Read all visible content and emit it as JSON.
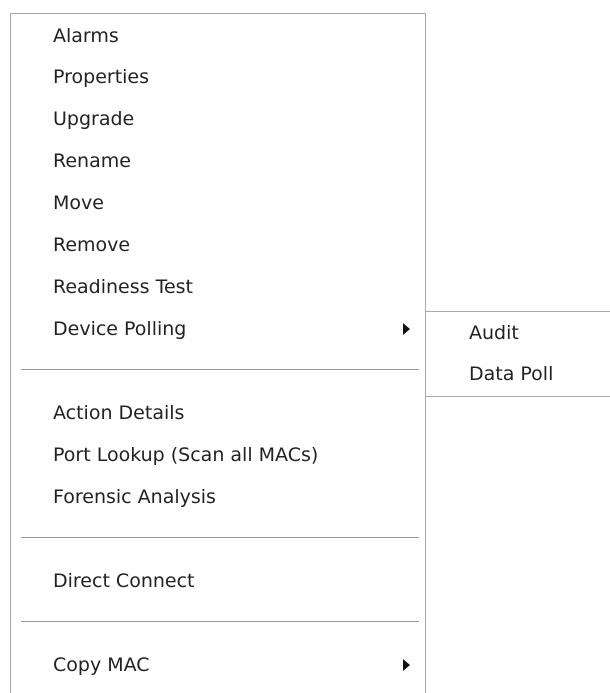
{
  "context_menu": {
    "items": [
      {
        "label": "Alarms"
      },
      {
        "label": "Properties"
      },
      {
        "label": "Upgrade"
      },
      {
        "label": "Rename"
      },
      {
        "label": "Move"
      },
      {
        "label": "Remove"
      },
      {
        "label": "Readiness Test"
      },
      {
        "label": "Device Polling"
      },
      {
        "label": "Action Details"
      },
      {
        "label": "Port Lookup (Scan all MACs)"
      },
      {
        "label": "Forensic Analysis"
      },
      {
        "label": "Direct Connect"
      },
      {
        "label": "Copy MAC"
      }
    ],
    "submenu_icon": "caret-right-icon"
  },
  "device_polling_submenu": {
    "items": [
      {
        "label": "Audit"
      },
      {
        "label": "Data Poll"
      }
    ]
  }
}
